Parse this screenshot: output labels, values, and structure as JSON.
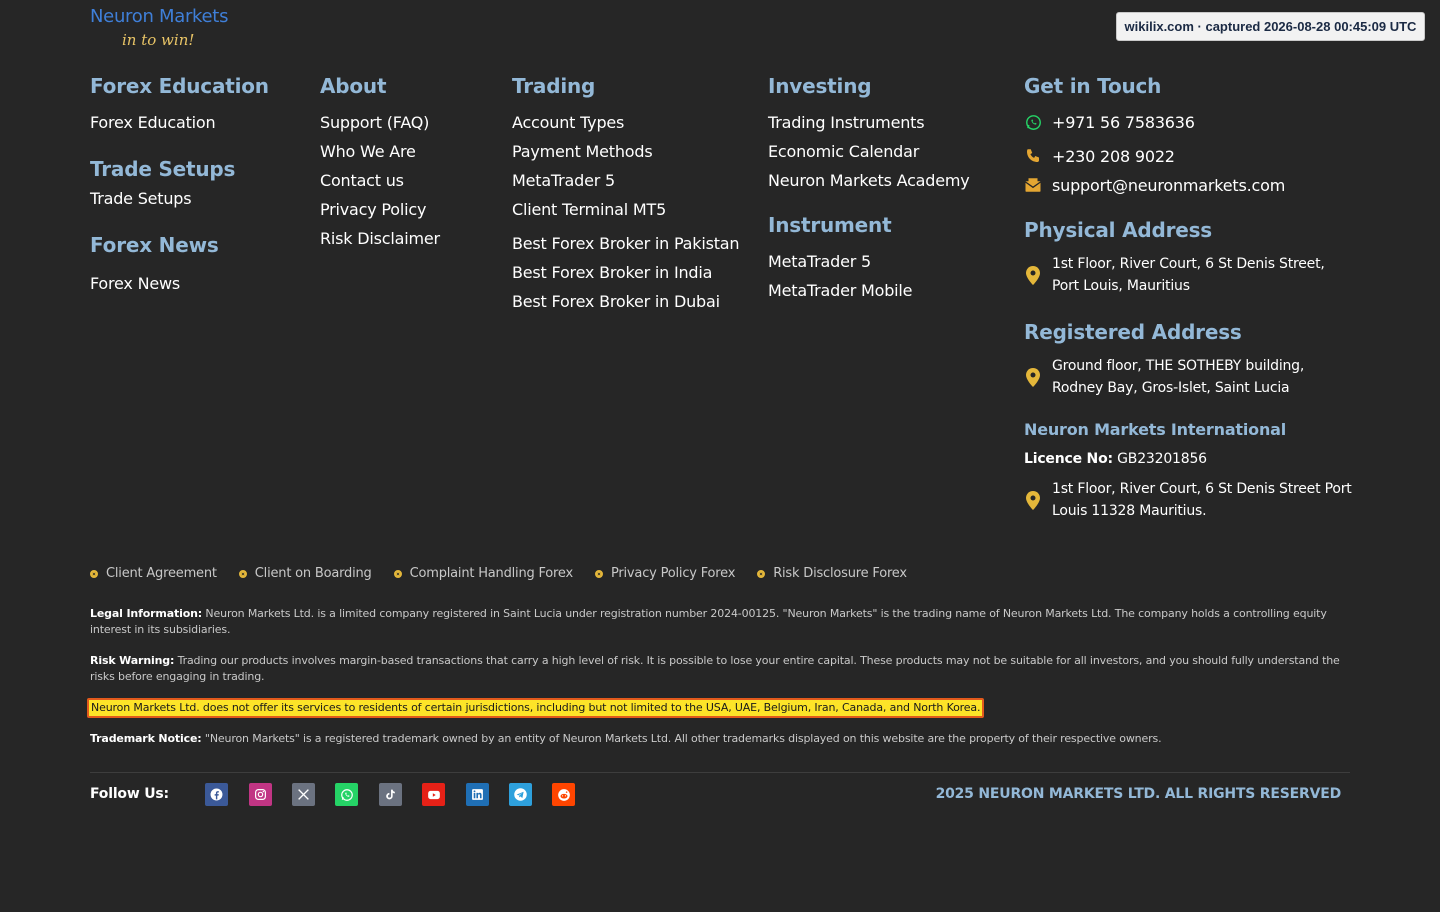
{
  "logo": {
    "name": "Neuron Markets",
    "tagline": "in to win!"
  },
  "capture_badge": "wikilix.com · captured 2026-08-28 00:45:09 UTC",
  "education": {
    "sections": [
      {
        "heading": "Forex Education",
        "links": [
          "Forex Education"
        ]
      },
      {
        "heading": "Trade Setups",
        "links": [
          "Trade Setups"
        ]
      },
      {
        "heading": "Forex News",
        "links": [
          "Forex News"
        ]
      }
    ]
  },
  "about": {
    "heading": "About",
    "links": [
      "Support (FAQ)",
      "Who We Are",
      "Contact us",
      "Privacy Policy",
      "Risk Disclaimer"
    ]
  },
  "trading": {
    "heading": "Trading",
    "links": [
      "Account Types",
      "Payment Methods",
      "MetaTrader 5",
      "Client Terminal MT5",
      "Best Forex Broker in Pakistan",
      "Best Forex Broker in India",
      "Best Forex Broker in Dubai"
    ]
  },
  "investing": {
    "heading": "Investing",
    "links": [
      "Trading Instruments",
      "Economic Calendar",
      "Neuron Markets Academy"
    ]
  },
  "instrument": {
    "heading": "Instrument",
    "links": [
      "MetaTrader 5",
      "MetaTrader Mobile"
    ]
  },
  "contact": {
    "heading": "Get in Touch",
    "whatsapp": "+971 56 7583636",
    "phone": "+230 208 9022",
    "email": "support@neuronmarkets.com"
  },
  "physical_address": {
    "heading": "Physical Address",
    "line1": "1st Floor, River Court, 6 St Denis Street,",
    "line2": "Port Louis, Mauritius"
  },
  "registered_address": {
    "heading": "Registered Address",
    "line1": "Ground floor, THE SOTHEBY building,",
    "line2": "Rodney Bay, Gros-Islet, Saint Lucia"
  },
  "international": {
    "heading": "Neuron Markets International",
    "licence_label": "Licence No:",
    "licence_value": "GB23201856",
    "line1": "1st Floor, River Court, 6 St Denis Street Port",
    "line2": "Louis 11328 Mauritius."
  },
  "policies": [
    "Client Agreement",
    "Client on Boarding",
    "Complaint Handling Forex",
    "Privacy Policy Forex",
    "Risk Disclosure Forex"
  ],
  "legal": {
    "legal_label": "Legal Information:",
    "legal_text": "Neuron Markets Ltd. is a limited company registered in Saint Lucia under registration number 2024-00125. \"Neuron Markets\" is the trading name of Neuron Markets Ltd. The company holds a controlling equity interest in its subsidiaries.",
    "risk_label": "Risk Warning:",
    "risk_text": "Trading our products involves margin-based transactions that carry a high level of risk. It is possible to lose your entire capital. These products may not be suitable for all investors, and you should fully understand the risks before engaging in trading.",
    "restriction": "Neuron Markets Ltd. does not offer its services to residents of certain jurisdictions, including but not limited to the USA, UAE, Belgium, Iran, Canada, and North Korea.",
    "trademark_label": "Trademark Notice:",
    "trademark_text": "\"Neuron Markets\" is a registered trademark owned by an entity of Neuron Markets Ltd. All other trademarks displayed on this website are the property of their respective owners."
  },
  "footer": {
    "follow_label": "Follow Us:",
    "social": [
      {
        "icon": "facebook-icon",
        "color": "#3b5998"
      },
      {
        "icon": "instagram-icon",
        "color": "#c13584"
      },
      {
        "icon": "x-icon",
        "color": "#6b7280"
      },
      {
        "icon": "whatsapp-icon",
        "color": "#25d366"
      },
      {
        "icon": "tiktok-icon",
        "color": "#6b7280"
      },
      {
        "icon": "youtube-icon",
        "color": "#e62117"
      },
      {
        "icon": "linkedin-icon",
        "color": "#1f6fb5"
      },
      {
        "icon": "telegram-icon",
        "color": "#2ea0dc"
      },
      {
        "icon": "reddit-icon",
        "color": "#ff4500"
      }
    ],
    "copyright": "2025 NEURON MARKETS LTD. ALL RIGHTS RESERVED"
  },
  "colors": {
    "background": "#262626",
    "heading": "#93b8d7",
    "accent": "#e4b73a",
    "logo": "#3f7fd8"
  }
}
